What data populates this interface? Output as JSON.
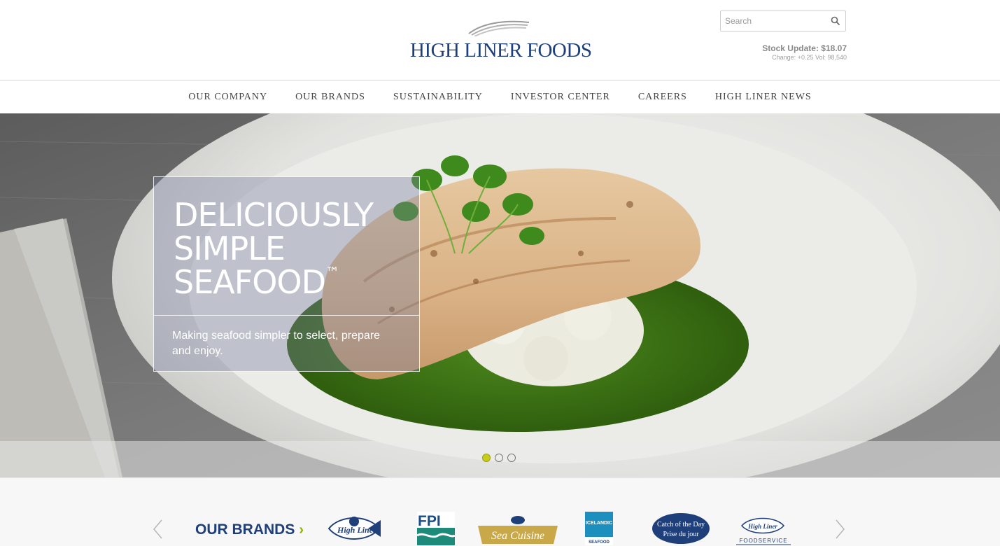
{
  "header": {
    "logo_text": "HIGH LINER FOODS",
    "search_placeholder": "Search",
    "stock_update": "Stock Update: $18.07",
    "stock_change": "Change: +0.25 Vol: 98,540"
  },
  "nav": {
    "items": [
      "OUR COMPANY",
      "OUR BRANDS",
      "SUSTAINABILITY",
      "INVESTOR CENTER",
      "CAREERS",
      "HIGH LINER NEWS"
    ]
  },
  "hero": {
    "title_line1": "DELICIOUSLY",
    "title_line2": "SIMPLE",
    "title_line3": "SEAFOOD",
    "trademark": "™",
    "subtitle": "Making seafood simpler to select, prepare and enjoy.",
    "slides_total": 3,
    "active_slide": 1
  },
  "brands": {
    "heading": "OUR BRANDS",
    "heading_chevron": "›",
    "items": [
      {
        "name": "High Liner",
        "label": "High Liner"
      },
      {
        "name": "FPI",
        "label": "FPI"
      },
      {
        "name": "Sea Cuisine",
        "label": "Sea Cuisine"
      },
      {
        "name": "Icelandic Seafood",
        "label": "ICELANDIC",
        "label2": "SEAFOOD"
      },
      {
        "name": "Catch of the Day",
        "label": "Catch of the Day",
        "label2": "Prise du jour"
      },
      {
        "name": "High Liner Foodservice",
        "label": "High Liner",
        "label2": "FOODSERVICE"
      }
    ]
  },
  "colors": {
    "brand_navy": "#1f3f7a",
    "accent_green": "#8ab000",
    "dot_active": "#c8cc1a"
  }
}
